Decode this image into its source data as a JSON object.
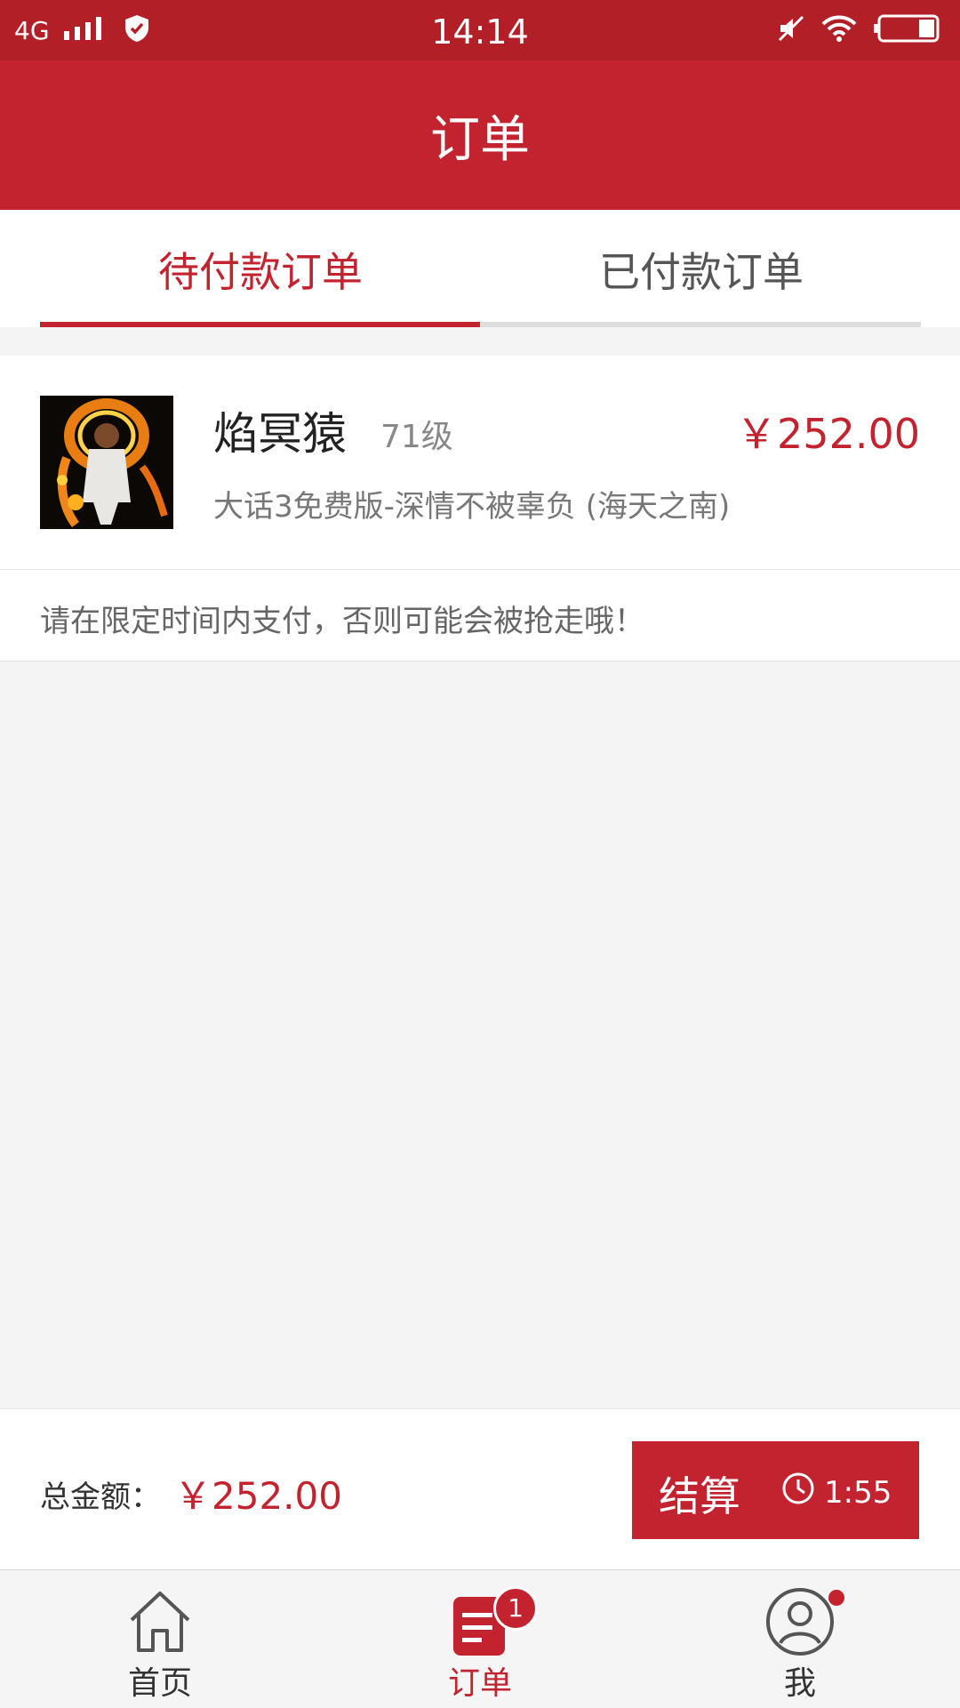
{
  "status_bar": {
    "network": "4G",
    "time": "14:14",
    "icons": [
      "signal-icon",
      "shield-icon",
      "mute-icon",
      "wifi-icon",
      "battery-icon"
    ]
  },
  "app_bar": {
    "title": "订单"
  },
  "tabs": [
    {
      "label": "待付款订单",
      "active": true
    },
    {
      "label": "已付款订单",
      "active": false
    }
  ],
  "order": {
    "name": "焰冥猿",
    "level": "71级",
    "price": "￥252.00",
    "server": "大话3免费版-深情不被辜负 (海天之南)"
  },
  "notice": "请在限定时间内支付，否则可能会被抢走哦！",
  "checkout": {
    "total_label": "总金额：",
    "total_value": "￥252.00",
    "pay_label": "结算",
    "countdown": "1:55"
  },
  "bottom_nav": [
    {
      "label": "首页",
      "icon": "home-icon",
      "active": false
    },
    {
      "label": "订单",
      "icon": "orders-icon",
      "active": true,
      "badge": "1"
    },
    {
      "label": "我",
      "icon": "profile-icon",
      "active": false,
      "dot": true
    }
  ],
  "colors": {
    "accent": "#c3232f",
    "status_bar": "#b31f27"
  }
}
